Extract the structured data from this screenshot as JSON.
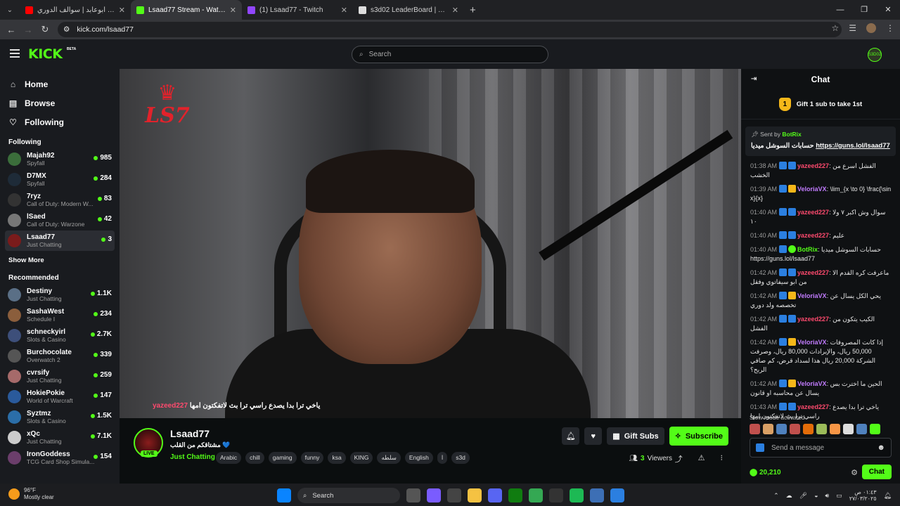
{
  "browser": {
    "tabs": [
      {
        "title": "عشاء مع ابوعابد | سوالف الدوري",
        "icon": "youtube-icon",
        "color": "#ff0000"
      },
      {
        "title": "Lsaad77 Stream - Watch Live o",
        "icon": "kick-icon",
        "color": "#53fc18"
      },
      {
        "title": "(1) Lsaad77 - Twitch",
        "icon": "twitch-icon",
        "color": "#9146ff"
      },
      {
        "title": "s3d02 LeaderBoard | The best C",
        "icon": "generic-site-icon",
        "color": "#dddddd"
      }
    ],
    "url": "kick.com/lsaad77"
  },
  "header": {
    "logo": "KICK",
    "beta": "BETA",
    "search_placeholder": "Search",
    "user_avatar": "S3D02"
  },
  "sidebar": {
    "nav": [
      {
        "label": "Home",
        "icon": "home-icon",
        "glyph": "⌂"
      },
      {
        "label": "Browse",
        "icon": "browse-icon",
        "glyph": "▤"
      },
      {
        "label": "Following",
        "icon": "heart-icon",
        "glyph": "♡"
      }
    ],
    "following_title": "Following",
    "following": [
      {
        "name": "Majah92",
        "category": "Spyfall",
        "viewers": "985",
        "color": "#3b6e3b"
      },
      {
        "name": "D7MX",
        "category": "Spyfall",
        "viewers": "284",
        "color": "#1e2b38"
      },
      {
        "name": "7ryz",
        "category": "Call of Duty: Modern W...",
        "viewers": "83",
        "color": "#333333"
      },
      {
        "name": "lSaed",
        "category": "Call of Duty: Warzone",
        "viewers": "42",
        "color": "#777777"
      },
      {
        "name": "Lsaad77",
        "category": "Just Chatting",
        "viewers": "3",
        "color": "#7a1b1b"
      }
    ],
    "show_more": "Show More",
    "recommended_title": "Recommended",
    "recommended": [
      {
        "name": "Destiny",
        "category": "Just Chatting",
        "viewers": "1.1K",
        "color": "#5a6f86"
      },
      {
        "name": "SashaWest",
        "category": "Schedule I",
        "viewers": "234",
        "color": "#8b5e3c"
      },
      {
        "name": "schneckyirl",
        "category": "Slots & Casino",
        "viewers": "2.7K",
        "color": "#3d4f7a"
      },
      {
        "name": "Burchocolate",
        "category": "Overwatch 2",
        "viewers": "339",
        "color": "#555555"
      },
      {
        "name": "cvrsify",
        "category": "Just Chatting",
        "viewers": "259",
        "color": "#a66a6a"
      },
      {
        "name": "HokiePokie",
        "category": "World of Warcraft",
        "viewers": "147",
        "color": "#2a5a9b"
      },
      {
        "name": "Syztmz",
        "category": "Slots & Casino",
        "viewers": "1.5K",
        "color": "#2b6ea8"
      },
      {
        "name": "xQc",
        "category": "Just Chatting",
        "viewers": "7.1K",
        "color": "#cccccc"
      },
      {
        "name": "IronGoddess",
        "category": "TCG Card Shop Simula...",
        "viewers": "154",
        "color": "#6b3e6b"
      }
    ]
  },
  "video": {
    "overlay_logo": "LS7",
    "caption_user": "yazeed227",
    "caption_text": "ياخي ترا بدا يصدع راسي ترا بث لاتفكتون امها"
  },
  "stream": {
    "name": "Lsaad77",
    "title": "مشتاقكم من القلب 💙",
    "category": "Just Chatting",
    "live": "LIVE",
    "tags": [
      "Arabic",
      "chill",
      "gaming",
      "funny",
      "ksa",
      "KING",
      "سلطه",
      "English",
      "ا",
      "s3d"
    ],
    "gift_subs": "Gift Subs",
    "subscribe": "Subscribe",
    "viewers_count": "3",
    "viewers_label": "Viewers"
  },
  "chat": {
    "title": "Chat",
    "gift_rank": "1",
    "gift_text": "Gift 1 sub to take 1st",
    "pinned_by_label": "Sent by",
    "pinned_by": "BotRix",
    "pinned_text": "حسابات السوشل ميديا",
    "pinned_link": "https://guns.lol/lsaad77",
    "messages": [
      {
        "time": "01:38 AM",
        "user": "yazeed227",
        "color": "#ff4a6e",
        "badge": "bd",
        "text": "الفشل اسرع من الخشب"
      },
      {
        "time": "01:39 AM",
        "user": "VeloriaVX",
        "color": "#c27cff",
        "badge": "bd2",
        "text": "\\lim_{x \\to 0} \\frac{\\sin x}{x}"
      },
      {
        "time": "01:40 AM",
        "user": "yazeed227",
        "color": "#ff4a6e",
        "badge": "bd",
        "text": "سوال وش اكبر ٧ ولا ١٠"
      },
      {
        "time": "01:40 AM",
        "user": "yazeed227",
        "color": "#ff4a6e",
        "badge": "bd",
        "text": "عليم"
      },
      {
        "time": "01:40 AM",
        "user": "BotRix",
        "color": "#53fc18",
        "badge": "bd3",
        "text": "حسابات السوشل ميديا https://guns.lol/lsaad77"
      },
      {
        "time": "01:42 AM",
        "user": "yazeed227",
        "color": "#ff4a6e",
        "badge": "bd",
        "text": "ماعرفت كره القدم الا من ابو سيفاتوي وفقل"
      },
      {
        "time": "01:42 AM",
        "user": "VeloriaVX",
        "color": "#c27cff",
        "badge": "bd2",
        "text": "يحي الكل يسال عن تخصصه ولد دوري"
      },
      {
        "time": "01:42 AM",
        "user": "yazeed227",
        "color": "#ff4a6e",
        "badge": "bd",
        "text": "الكيب يتكون من الفشل"
      },
      {
        "time": "01:42 AM",
        "user": "VeloriaVX",
        "color": "#c27cff",
        "badge": "bd2",
        "text": "إذا كانت المصروفات 50,000 ريال، والإيرادات 80,000 ريال، وصرفت الشركة 20,000 ريال هذا لسداد قرض، كم صافي الربح؟"
      },
      {
        "time": "01:42 AM",
        "user": "VeloriaVX",
        "color": "#c27cff",
        "badge": "bd2",
        "text": "الحين ما اخترت بس يسال عن محاسبه او قانون"
      },
      {
        "time": "01:43 AM",
        "user": "yazeed227",
        "color": "#ff4a6e",
        "badge": "bd",
        "text": "ياخي ترا بدا يصدع راسي ترا بث لاتفكتون امها"
      }
    ],
    "slow_mode": "Slow mode activated",
    "send_placeholder": "Send a message",
    "points": "20,210",
    "chat_button": "Chat"
  },
  "taskbar": {
    "temp": "96°F",
    "weather": "Mostly clear",
    "search": "Search",
    "time": "٠١:٤٣ ص",
    "date": "٢٧/٠٣/٢٠٢٥"
  }
}
